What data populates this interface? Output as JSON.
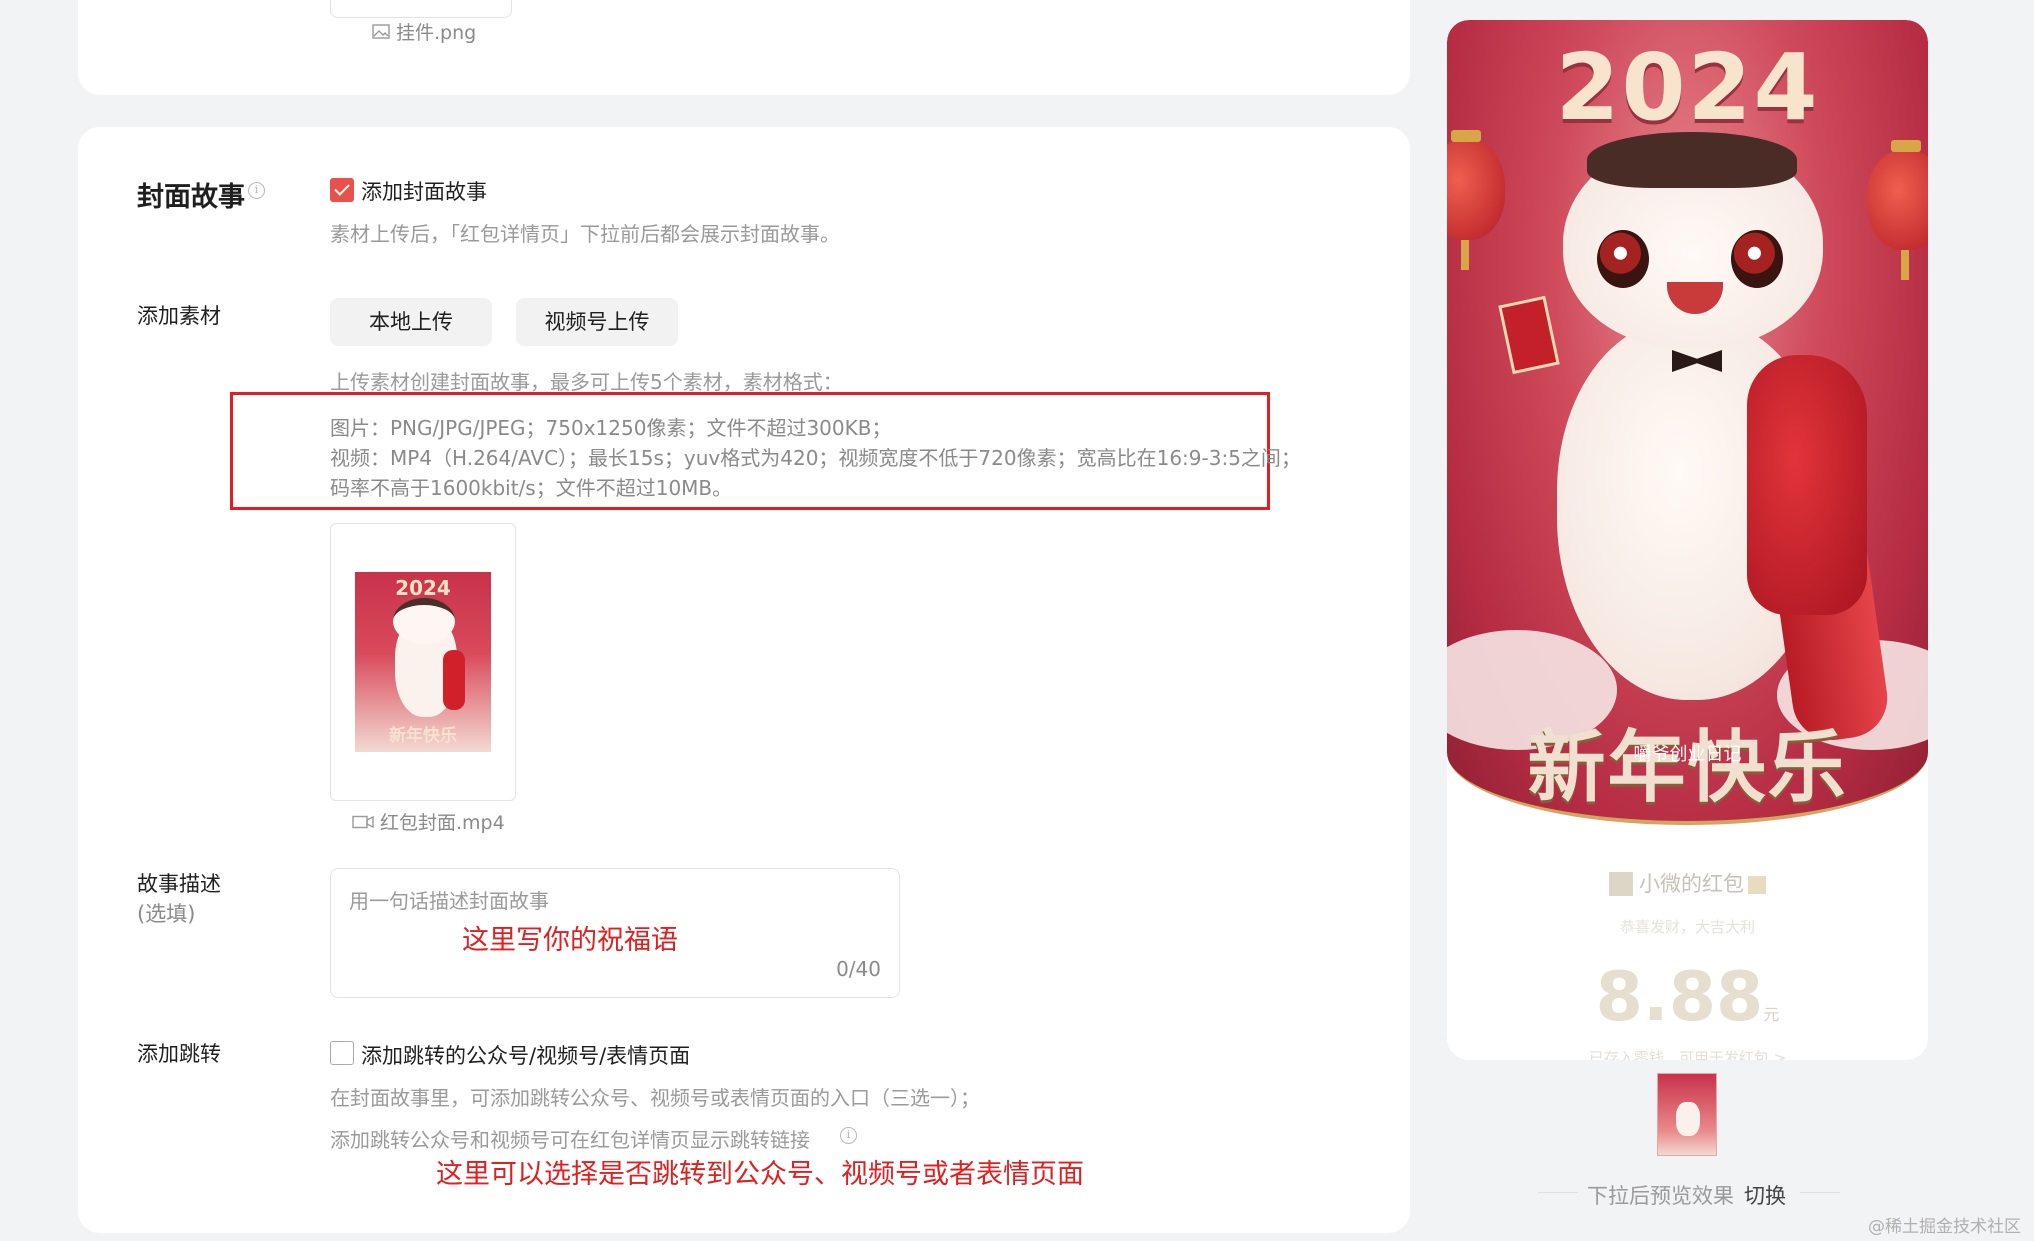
{
  "top_section": {
    "pendant_file": "挂件.png"
  },
  "cover_story": {
    "label": "封面故事",
    "info_icon": "info-icon",
    "checkbox_label": "添加封面故事",
    "checkbox_checked": true,
    "hint": "素材上传后，「红包详情页」下拉前后都会展示封面故事。"
  },
  "add_material": {
    "label": "添加素材",
    "local_upload": "本地上传",
    "channels_upload": "视频号上传",
    "intro": "上传素材创建封面故事，最多可上传5个素材，素材格式：",
    "spec_image": "图片：PNG/JPG/JPEG；750x1250像素；文件不超过300KB；",
    "spec_video": "视频：MP4（H.264/AVC）；最长15s；yuv格式为420；视频宽度不低于720像素；宽高比在16:9-3:5之间；",
    "spec_bitrate": "码率不高于1600kbit/s；文件不超过10MB。",
    "video_file": "红包封面.mp4",
    "mini_year": "2024",
    "mini_text": "新年快乐"
  },
  "story_desc": {
    "label": "故事描述",
    "sub_label": "(选填)",
    "placeholder": "用一句话描述封面故事",
    "counter": "0/40",
    "annotation": "这里写你的祝福语"
  },
  "add_jump": {
    "label": "添加跳转",
    "checkbox_label": "添加跳转的公众号/视频号/表情页面",
    "checkbox_checked": false,
    "hint1": "在封面故事里，可添加跳转公众号、视频号或表情页面的入口（三选一）；",
    "hint2": "添加跳转公众号和视频号可在红包详情页显示跳转链接",
    "annotation": "这里可以选择是否跳转到公众号、视频号或者表情页面"
  },
  "preview": {
    "poster_year": "2024",
    "poster_text": "新年快乐",
    "watermark": "嚼爷创业日记",
    "sender": "小微的红包",
    "blessing": "恭喜发财，大吉大利",
    "amount": "8.88",
    "currency": "元",
    "stored": "已存入零钱，可用于发红包 >",
    "footer_text": "下拉后预览效果",
    "switch_link": "切换"
  },
  "site_mark": "@稀土掘金技术社区",
  "colors": {
    "accent_red": "#e02020",
    "checkbox_red": "#e8524a",
    "hint_gray": "#9a9a9a"
  }
}
